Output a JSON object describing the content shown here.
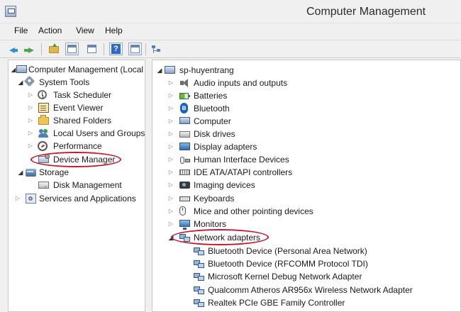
{
  "window": {
    "title": "Computer Management"
  },
  "menu": [
    "File",
    "Action",
    "View",
    "Help"
  ],
  "toolbar": {
    "buttons": [
      "back-arrow-icon",
      "forward-arrow-icon",
      "up-folder-icon",
      "show-hide-tree-icon",
      "properties-icon",
      "help-icon",
      "action-pane-icon",
      "device-tree-icon"
    ]
  },
  "left_tree": {
    "root": "Computer Management (Local",
    "system_tools": "System Tools",
    "task_scheduler": "Task Scheduler",
    "event_viewer": "Event Viewer",
    "shared_folders": "Shared Folders",
    "local_users": "Local Users and Groups",
    "performance": "Performance",
    "device_manager": "Device Manager",
    "storage": "Storage",
    "disk_management": "Disk Management",
    "services": "Services and Applications"
  },
  "device_tree": {
    "root": "sp-huyentrang",
    "categories": [
      "Audio inputs and outputs",
      "Batteries",
      "Bluetooth",
      "Computer",
      "Disk drives",
      "Display adapters",
      "Human Interface Devices",
      "IDE ATA/ATAPI controllers",
      "Imaging devices",
      "Keyboards",
      "Mice and other pointing devices",
      "Monitors",
      "Network adapters"
    ],
    "network_adapters": [
      "Bluetooth Device (Personal Area Network)",
      "Bluetooth Device (RFCOMM Protocol TDI)",
      "Microsoft Kernel Debug Network Adapter",
      "Qualcomm Atheros AR956x Wireless Network Adapter",
      "Realtek PCIe GBE Family Controller"
    ]
  },
  "colors": {
    "highlight_ellipse": "#c6192c",
    "accent": "#2a8fd4"
  }
}
